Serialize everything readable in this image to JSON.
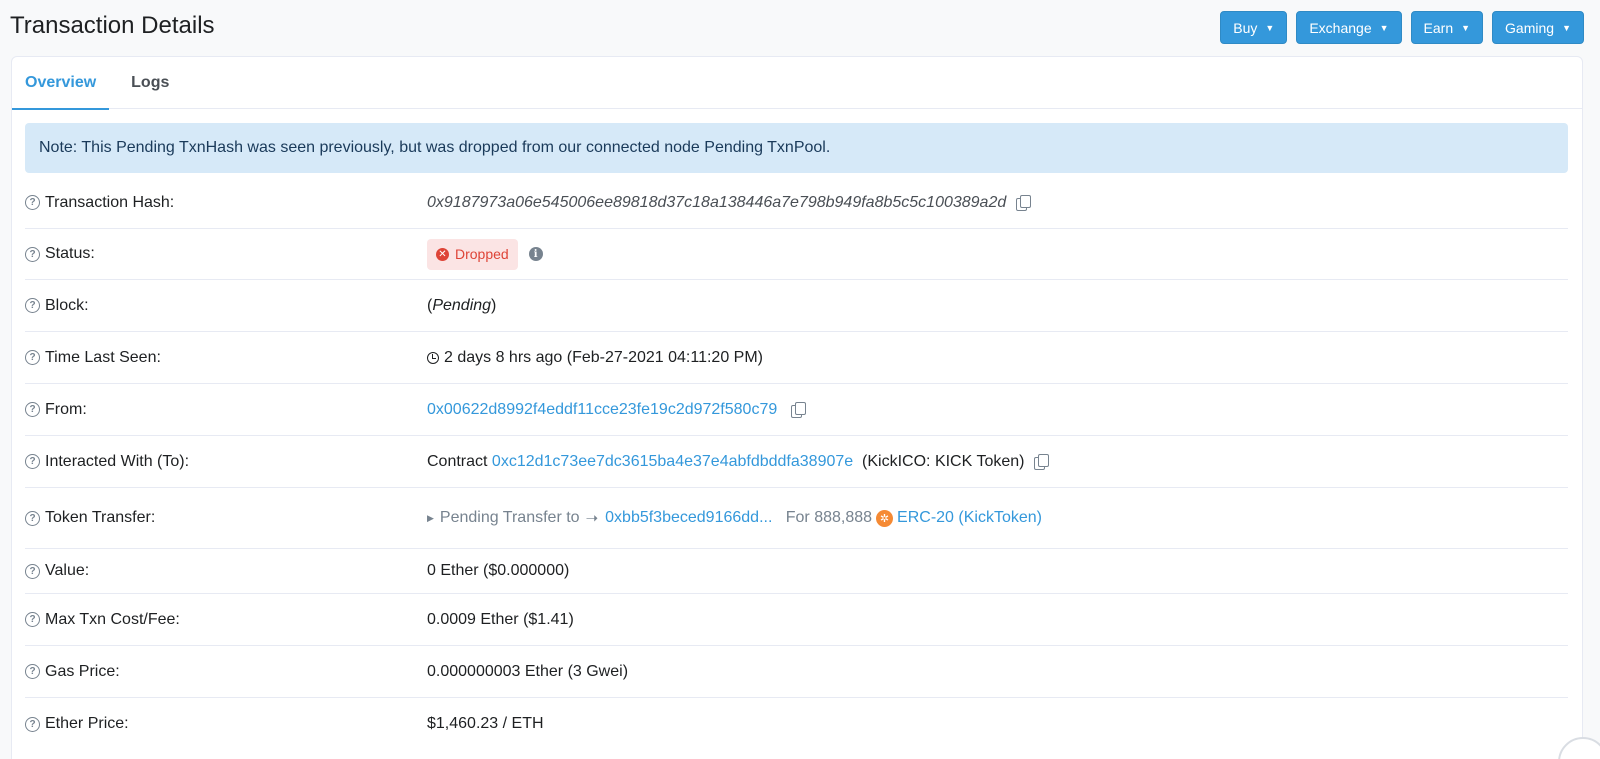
{
  "page": {
    "title": "Transaction Details"
  },
  "top_buttons": [
    {
      "label": "Buy"
    },
    {
      "label": "Exchange"
    },
    {
      "label": "Earn"
    },
    {
      "label": "Gaming"
    }
  ],
  "tabs": [
    {
      "label": "Overview",
      "active": true
    },
    {
      "label": "Logs",
      "active": false
    }
  ],
  "note": "Note: This Pending TxnHash was seen previously, but was dropped from our connected node Pending TxnPool.",
  "fields": {
    "tx_hash": {
      "label": "Transaction Hash:",
      "value": "0x9187973a06e545006ee89818d37c18a138446a7e798b949fa8b5c5c100389a2d"
    },
    "status": {
      "label": "Status:",
      "value": "Dropped"
    },
    "block": {
      "label": "Block:",
      "open": "(",
      "value": "Pending",
      "close": ")"
    },
    "time_last_seen": {
      "label": "Time Last Seen:",
      "value": "2 days 8 hrs ago (Feb-27-2021 04:11:20 PM)"
    },
    "from": {
      "label": "From:",
      "value": "0x00622d8992f4eddf11cce23fe19c2d972f580c79"
    },
    "to": {
      "label": "Interacted With (To):",
      "prefix": "Contract",
      "address": "0xc12d1c73ee7dc3615ba4e37e4abfdbddfa38907e",
      "name": "(KickICO: KICK Token)"
    },
    "token_transfer": {
      "label": "Token Transfer:",
      "pending_text": "Pending Transfer to",
      "to_address": "0xbb5f3beced9166dd...",
      "for_text": "For 888,888",
      "token": "ERC-20 (KickToken)"
    },
    "value": {
      "label": "Value:",
      "value": "0 Ether ($0.000000)"
    },
    "max_fee": {
      "label": "Max Txn Cost/Fee:",
      "value": "0.0009 Ether ($1.41)"
    },
    "gas_price": {
      "label": "Gas Price:",
      "value": "0.000000003 Ether (3 Gwei)"
    },
    "ether_price": {
      "label": "Ether Price:",
      "value": "$1,460.23 / ETH"
    }
  },
  "colors": {
    "accent": "#3498db",
    "danger": "#de4437",
    "note_bg": "#d6e9f8"
  }
}
